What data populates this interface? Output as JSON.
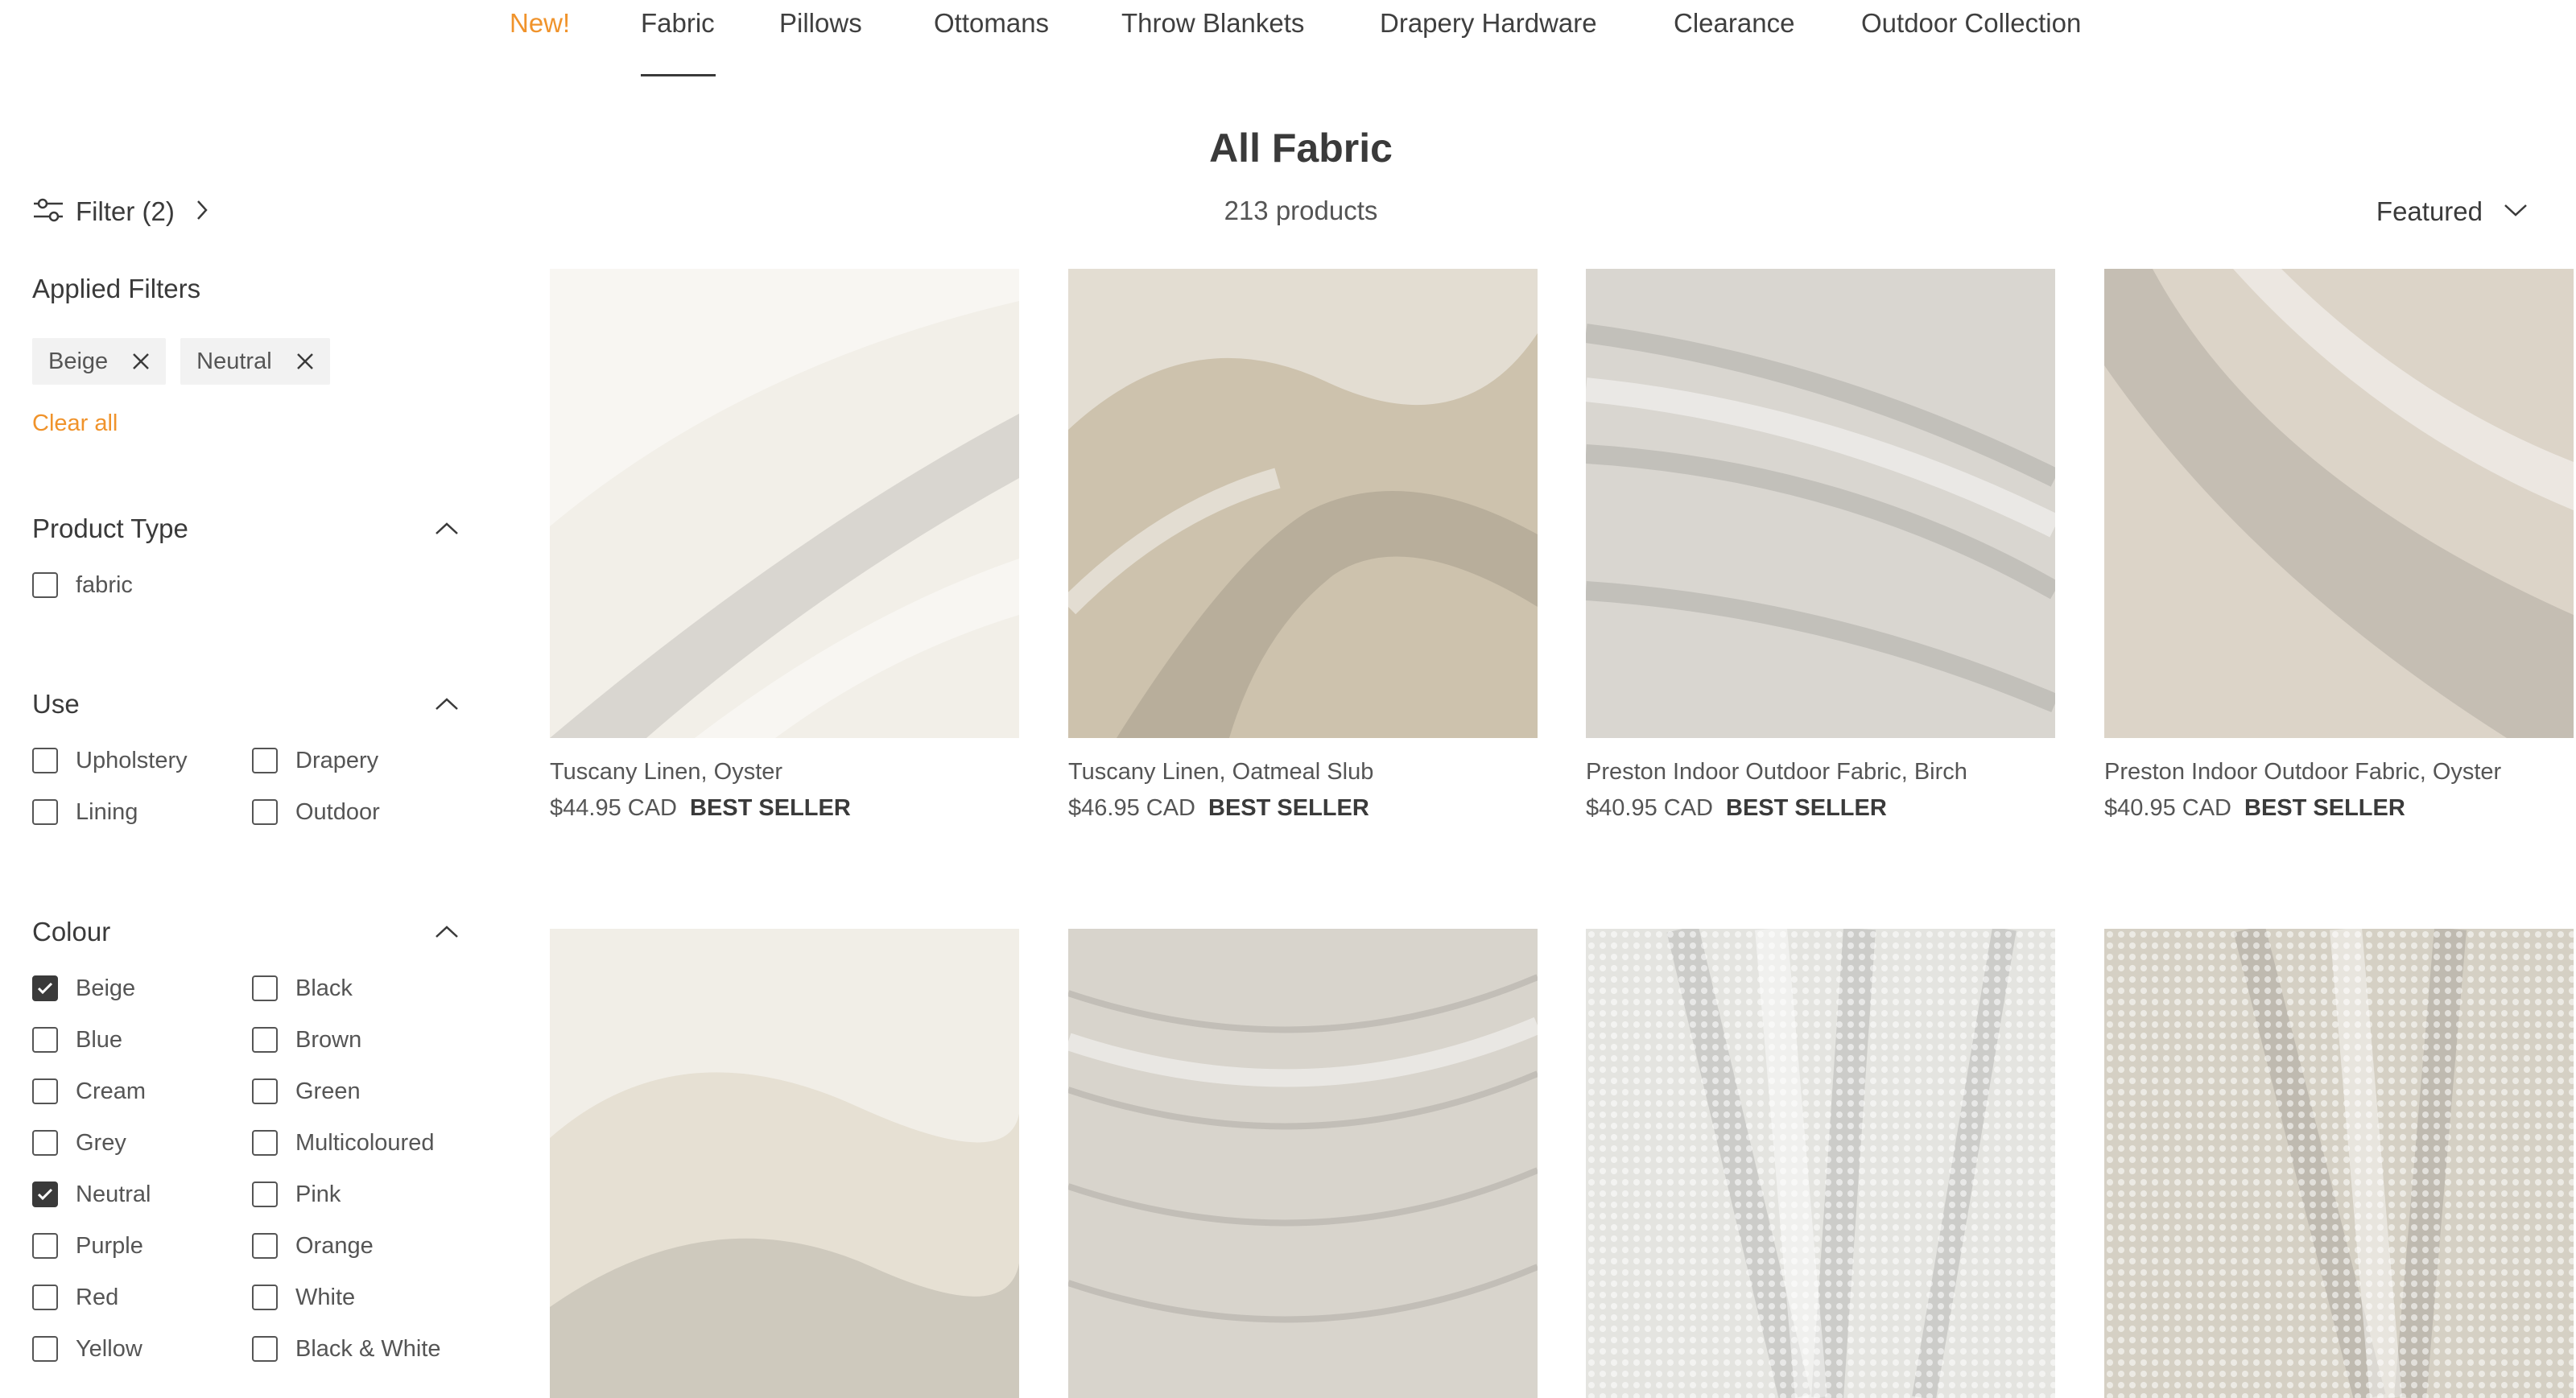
{
  "nav": {
    "items": [
      "New!",
      "Fabric",
      "Pillows",
      "Ottomans",
      "Throw Blankets",
      "Drapery Hardware",
      "Clearance",
      "Outdoor Collection"
    ],
    "active": "Fabric"
  },
  "collection": {
    "title": "All Fabric",
    "count": "213 products"
  },
  "filter_toggle": {
    "label": "Filter (2)"
  },
  "sort": {
    "label": "Featured"
  },
  "applied_filters": {
    "title": "Applied Filters",
    "chips": [
      "Beige",
      "Neutral"
    ],
    "clear_all": "Clear all"
  },
  "facets": {
    "product_type": {
      "title": "Product Type",
      "options": [
        {
          "label": "fabric",
          "checked": false
        }
      ]
    },
    "use": {
      "title": "Use",
      "options": [
        {
          "label": "Upholstery",
          "checked": false
        },
        {
          "label": "Drapery",
          "checked": false
        },
        {
          "label": "Lining",
          "checked": false
        },
        {
          "label": "Outdoor",
          "checked": false
        }
      ]
    },
    "colour": {
      "title": "Colour",
      "options": [
        {
          "label": "Beige",
          "checked": true
        },
        {
          "label": "Black",
          "checked": false
        },
        {
          "label": "Blue",
          "checked": false
        },
        {
          "label": "Brown",
          "checked": false
        },
        {
          "label": "Cream",
          "checked": false
        },
        {
          "label": "Green",
          "checked": false
        },
        {
          "label": "Grey",
          "checked": false
        },
        {
          "label": "Multicoloured",
          "checked": false
        },
        {
          "label": "Neutral",
          "checked": true
        },
        {
          "label": "Pink",
          "checked": false
        },
        {
          "label": "Purple",
          "checked": false
        },
        {
          "label": "Orange",
          "checked": false
        },
        {
          "label": "Red",
          "checked": false
        },
        {
          "label": "White",
          "checked": false
        },
        {
          "label": "Yellow",
          "checked": false
        },
        {
          "label": "Black & White",
          "checked": false
        }
      ]
    }
  },
  "products": [
    {
      "name": "Tuscany Linen, Oyster",
      "price": "$44.95 CAD",
      "badge": "BEST SELLER",
      "swatch": "#f2efe8"
    },
    {
      "name": "Tuscany Linen, Oatmeal Slub",
      "price": "$46.95 CAD",
      "badge": "BEST SELLER",
      "swatch": "#cdc2ad"
    },
    {
      "name": "Preston Indoor Outdoor Fabric, Birch",
      "price": "$40.95 CAD",
      "badge": "BEST SELLER",
      "swatch": "#d9d6d0"
    },
    {
      "name": "Preston Indoor Outdoor Fabric, Oyster",
      "price": "$40.95 CAD",
      "badge": "BEST SELLER",
      "swatch": "#dcd4c8"
    },
    {
      "name": "",
      "price": "",
      "badge": "",
      "swatch": "#e6e0d3"
    },
    {
      "name": "",
      "price": "",
      "badge": "",
      "swatch": "#d8d4cc"
    },
    {
      "name": "",
      "price": "",
      "badge": "",
      "swatch": "#e4e4e0"
    },
    {
      "name": "",
      "price": "",
      "badge": "",
      "swatch": "#d5d0c4"
    }
  ],
  "colors": {
    "accent": "#f0932b",
    "text": "#3a3a3a",
    "muted": "#555555",
    "chip_bg": "#f2f2f2"
  },
  "icons": {
    "filter": "sliders-icon",
    "close": "x-icon",
    "chevron_up": "chevron-up-icon",
    "chevron_down": "chevron-down-icon",
    "chevron_right": "chevron-right-icon",
    "check": "check-icon"
  }
}
